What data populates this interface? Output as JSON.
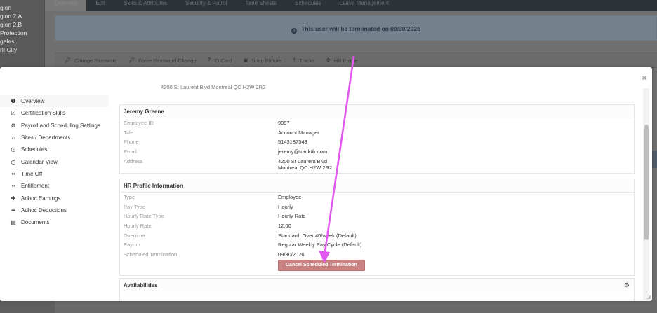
{
  "background": {
    "sidebar_items": [
      "gion",
      "gion 2.A",
      "gion 2.B",
      "Protection",
      "geles",
      "rk City"
    ],
    "tabs": [
      "Overview",
      "Edit",
      "Skills & Attributes",
      "Security & Patrol",
      "Time Sheets",
      "Schedules",
      "Leave Management"
    ],
    "banner": "This user will be terminated on 09/30/2026",
    "toolbar": {
      "change_password": "Change Password",
      "force_password_change": "Force Password Change",
      "id_card": "ID Card",
      "snap_picture": "Snap Picture",
      "tracks": "Tracks",
      "hr_profile": "HR Profile"
    }
  },
  "modal": {
    "close": "×",
    "sidebar": [
      {
        "label": "Overview",
        "icon": "info-icon"
      },
      {
        "label": "Certification Skills",
        "icon": "checkbox-icon"
      },
      {
        "label": "Payroll and Scheduling Settings",
        "icon": "gear-icon"
      },
      {
        "label": "Sites / Departments",
        "icon": "home-icon"
      },
      {
        "label": "Schedules",
        "icon": "clock-icon"
      },
      {
        "label": "Calendar View",
        "icon": "clock-icon"
      },
      {
        "label": "Time Off",
        "icon": "dots-icon"
      },
      {
        "label": "Entitlement",
        "icon": "dots-icon"
      },
      {
        "label": "Adhoc Earnings",
        "icon": "plus-icon"
      },
      {
        "label": "Adhoc Deductions",
        "icon": "minus-icon"
      },
      {
        "label": "Documents",
        "icon": "document-icon"
      }
    ],
    "cut_text": "4200 St Laurent Blvd Montreal QC H2W 2R2",
    "profile": {
      "title": "Jeremy Greene",
      "rows": [
        {
          "k": "Employee ID",
          "v": "9997"
        },
        {
          "k": "Title",
          "v": "Account Manager"
        },
        {
          "k": "Phone",
          "v": "5143187543"
        },
        {
          "k": "Email",
          "v": "jeremy@tracktik.com"
        }
      ],
      "address_label": "Address",
      "address_line1": "4200 St Laurent Blvd",
      "address_line2": "Montreal QC H2W 2R2"
    },
    "hr": {
      "title": "HR Profile Information",
      "rows": [
        {
          "k": "Type",
          "v": "Employee"
        },
        {
          "k": "Pay Type",
          "v": "Hourly"
        },
        {
          "k": "Hourly Rate Type",
          "v": "Hourly Rate"
        },
        {
          "k": "Hourly Rate",
          "v": "12.00"
        },
        {
          "k": "Overtime",
          "v": "Standard: Over 40/week (Default)"
        },
        {
          "k": "Payrun",
          "v": "Regular Weekly Pay Cycle (Default)"
        },
        {
          "k": "Scheduled Termination",
          "v": "09/30/2026"
        }
      ],
      "cancel_button": "Cancel Scheduled Termination"
    },
    "availabilities": {
      "title": "Availabilities"
    }
  },
  "annotation_color": "#e257f0"
}
